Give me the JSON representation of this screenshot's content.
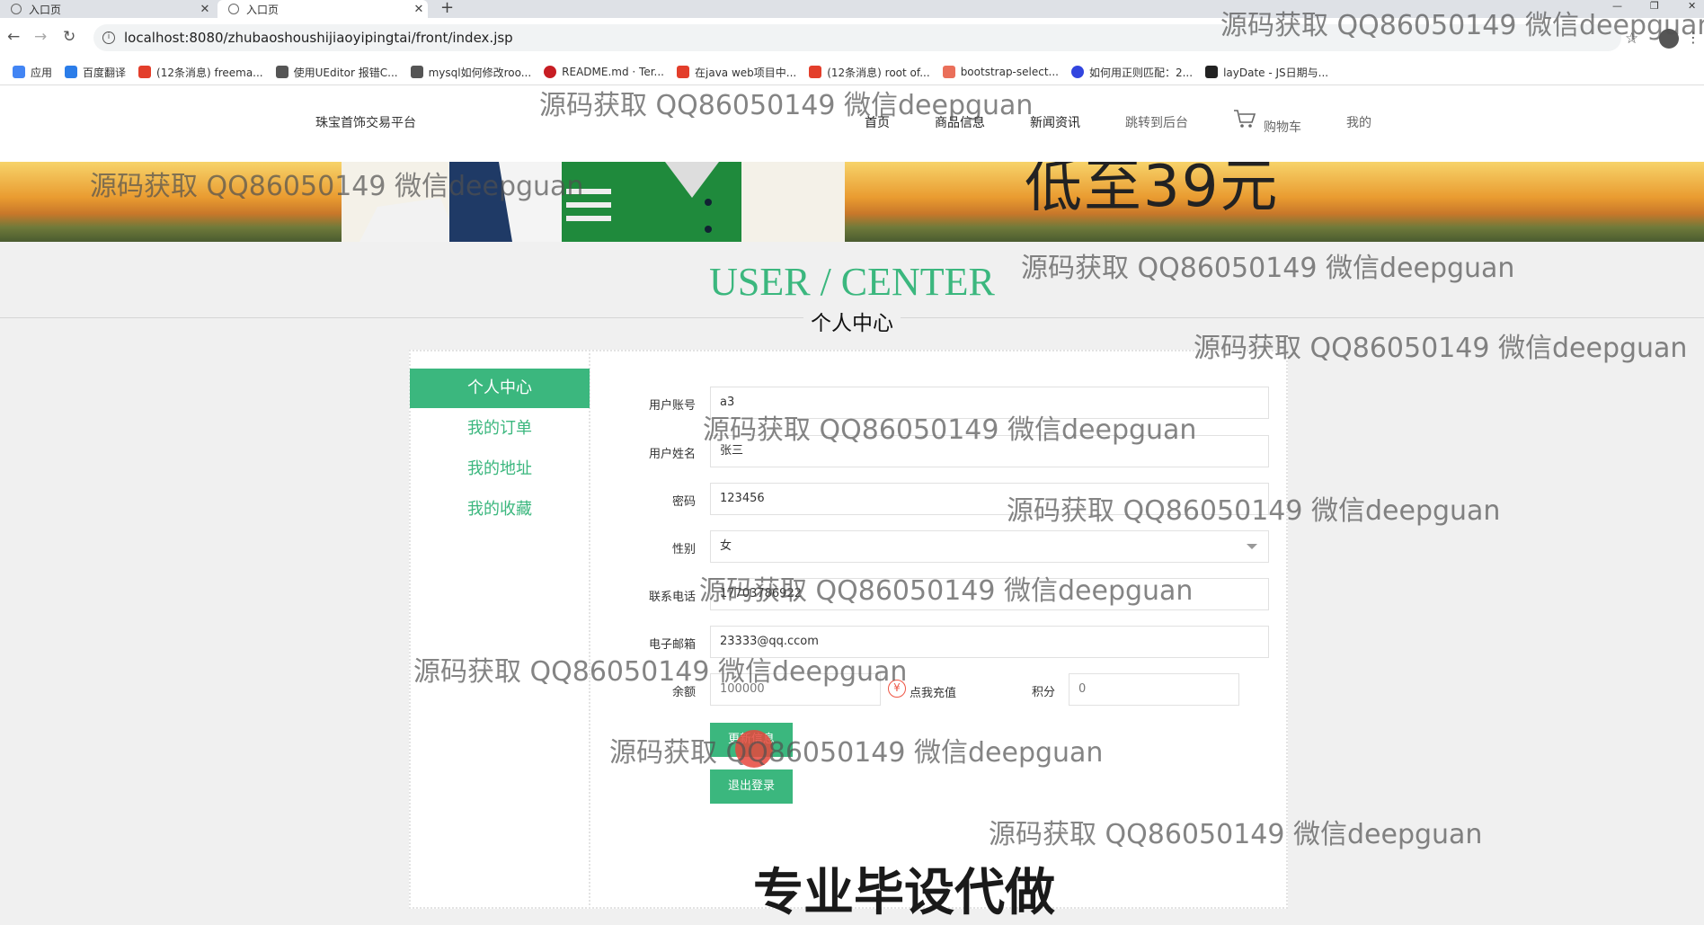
{
  "browser": {
    "tabs": [
      {
        "title": "入口页",
        "active": false
      },
      {
        "title": "入口页",
        "active": true
      }
    ],
    "new_tab_symbol": "+",
    "url": "localhost:8080/zhubaoshoushijiaoyipingtai/front/index.jsp",
    "bookmarks": [
      {
        "label": "应用",
        "icon": "apps-grid-icon",
        "color": "#4285f4"
      },
      {
        "label": "百度翻译",
        "icon": "baidu-translate-icon",
        "color": "#2b7de9"
      },
      {
        "label": "(12条消息) freema...",
        "icon": "csdn-icon",
        "color": "#e33e2b"
      },
      {
        "label": "使用UEditor 报错C...",
        "icon": "ueditor-icon",
        "color": "#555555"
      },
      {
        "label": "mysql如何修改roo...",
        "icon": "mysql-icon",
        "color": "#555555"
      },
      {
        "label": "README.md · Ter...",
        "icon": "gitee-icon",
        "color": "#c71d23"
      },
      {
        "label": "在java web项目中...",
        "icon": "csdn-icon",
        "color": "#e33e2b"
      },
      {
        "label": "(12条消息) root of...",
        "icon": "csdn-icon",
        "color": "#e33e2b"
      },
      {
        "label": "bootstrap-select...",
        "icon": "jianshu-icon",
        "color": "#ea6f5a"
      },
      {
        "label": "如何用正则匹配：2...",
        "icon": "baidu-paw-icon",
        "color": "#3245df"
      },
      {
        "label": "layDate - JS日期与...",
        "icon": "laydate-icon",
        "color": "#222222"
      }
    ]
  },
  "header": {
    "brand": "珠宝首饰交易平台",
    "nav": [
      "首页",
      "商品信息",
      "新闻资讯",
      "跳转到后台",
      "购物车",
      "我的"
    ]
  },
  "banner": {
    "promo_text": "低至39元"
  },
  "user_center": {
    "title_en": "USER / CENTER",
    "title_cn": "个人中心",
    "sidebar": [
      {
        "label": "个人中心",
        "active": true
      },
      {
        "label": "我的订单",
        "active": false
      },
      {
        "label": "我的地址",
        "active": false
      },
      {
        "label": "我的收藏",
        "active": false
      }
    ],
    "form": {
      "account_label": "用户账号",
      "account_value": "a3",
      "name_label": "用户姓名",
      "name_value": "张三",
      "password_label": "密码",
      "password_value": "123456",
      "gender_label": "性别",
      "gender_value": "女",
      "phone_label": "联系电话",
      "phone_value": "17703786922",
      "email_label": "电子邮箱",
      "email_value": "23333@qq.ccom",
      "balance_label": "余额",
      "balance_value": "100000",
      "recharge_icon": "¥",
      "recharge_label": "点我充值",
      "points_label": "积分",
      "points_value": "0",
      "update_button": "更新信息",
      "logout_button": "退出登录"
    }
  },
  "overlays": {
    "watermark": "源码获取 QQ86050149 微信deepguan",
    "promo_caption": "专业毕设代做"
  },
  "colors": {
    "accent": "#3bb77e"
  }
}
